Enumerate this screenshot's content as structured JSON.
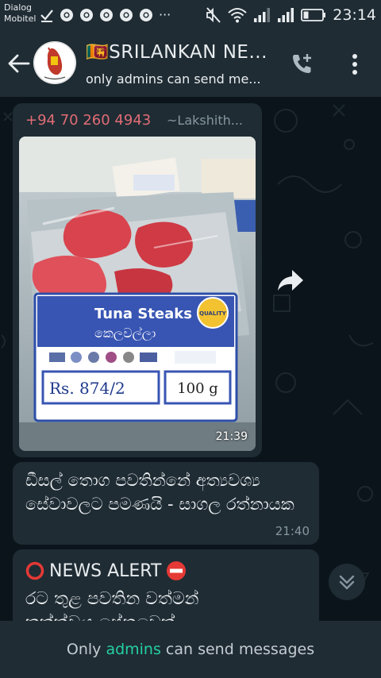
{
  "status_bar": {
    "carrier_line1": "Dialog",
    "carrier_line2": "Mobitel",
    "more": "···",
    "time": "23:14",
    "icons": [
      "download-check-icon",
      "chrome-icon",
      "chrome-icon",
      "chrome-icon",
      "chrome-icon",
      "chrome-icon",
      "mute-icon",
      "wifi-icon",
      "signal-icon",
      "signal-icon",
      "battery-icon"
    ]
  },
  "header": {
    "title": "🇱🇰SRILANKAN NE...",
    "subtitle": "only admins can send me...",
    "icons": [
      "back-arrow-icon",
      "group-avatar",
      "add-call-icon",
      "more-vert-icon"
    ]
  },
  "messages": [
    {
      "sender_phone": "+94 70 260 4943",
      "sender_name": "~Lakshith...",
      "photo": {
        "label_title": "Tuna Steaks",
        "label_sinhala": "කෙලවල්ලා",
        "price": "Rs. 874/2",
        "weight": "100 g",
        "seal_text": "QUALITY"
      },
      "time": "21:39"
    },
    {
      "text": "ඩීසල් තොග පවතින්නේ අත්‍යවශ්‍ය සේවාවලට පමණයි - සාගල රත්නායක",
      "time": "21:40"
    },
    {
      "line1_prefix_icon": "red-circle-icon",
      "line1": "NEWS ALERT",
      "line1_suffix_icon": "no-entry-icon",
      "line2": "රට තුළ පවතින වත්මන්",
      "line3": "තත්ත්වය පේනවෙක්"
    }
  ],
  "footer": {
    "prefix": "Only ",
    "highlight": "admins",
    "suffix": " can send messages"
  },
  "colors": {
    "background": "#0b141a",
    "bars": "#1f2c34",
    "bubble": "#1f2c34",
    "sender_phone": "#e06c75",
    "admins_accent": "#25d0a0"
  }
}
